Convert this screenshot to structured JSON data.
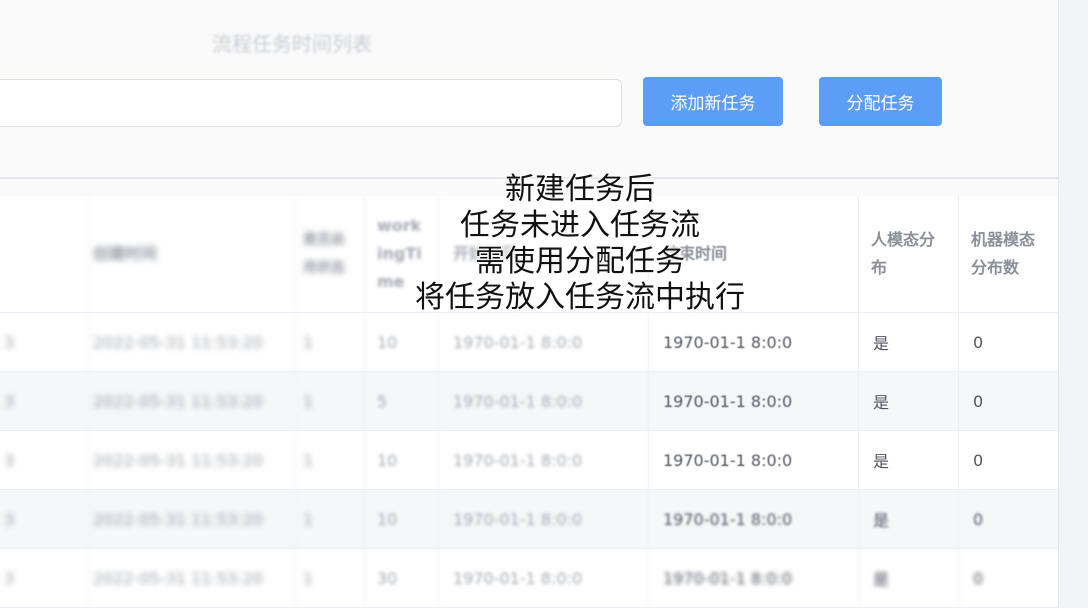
{
  "page": {
    "title": "流程任务时间列表"
  },
  "toolbar": {
    "search_value": "",
    "add_label": "添加新任务",
    "assign_label": "分配任务"
  },
  "table": {
    "headers": [
      "",
      "创建时间",
      "是否启用状态",
      "workingTime",
      "开始时间",
      "结束时间",
      "人模态分布",
      "机器模态分布数"
    ],
    "rows": [
      [
        "3",
        "2022-05-31 11:53:20",
        "1",
        "10",
        "1970-01-1 8:0:0",
        "1970-01-1 8:0:0",
        "是",
        "0"
      ],
      [
        "3",
        "2022-05-31 11:53:20",
        "1",
        "5",
        "1970-01-1 8:0:0",
        "1970-01-1 8:0:0",
        "是",
        "0"
      ],
      [
        "3",
        "2022-05-31 11:53:20",
        "1",
        "10",
        "1970-01-1 8:0:0",
        "1970-01-1 8:0:0",
        "是",
        "0"
      ],
      [
        "3",
        "2022-05-31 11:53:20",
        "1",
        "10",
        "1970-01-1 8:0:0",
        "1970-01-1 8:0:0",
        "是",
        "0"
      ],
      [
        "3",
        "2022-05-31 11:53:20",
        "1",
        "30",
        "1970-01-1 8:0:0",
        "1970-01-1 8:0:0",
        "是",
        "0"
      ]
    ]
  },
  "overlay": {
    "lines": [
      "新建任务后",
      "任务未进入任务流",
      "需使用分配任务",
      "将任务放入任务流中执行"
    ]
  },
  "colors": {
    "primary": "#5b9df7",
    "border": "#ebeef5"
  }
}
